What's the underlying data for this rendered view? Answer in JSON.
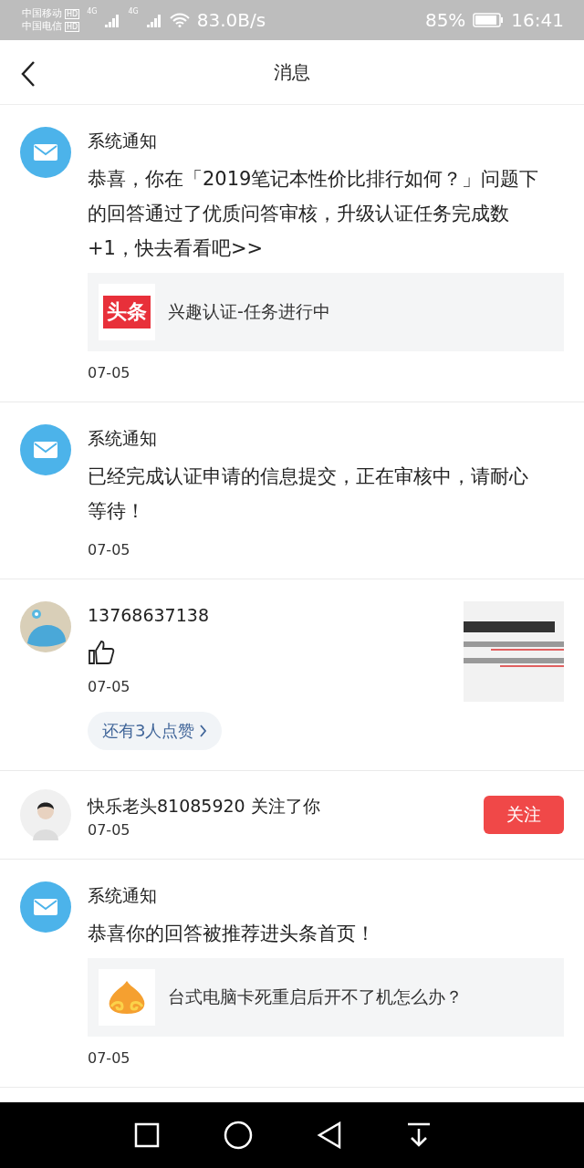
{
  "status_bar": {
    "carrier_1": "中国移动",
    "carrier_2": "中国电信",
    "hd_1": "HD",
    "hd_2": "HD",
    "net_1": "4G",
    "net_2": "4G",
    "speed": "83.0B/s",
    "battery": "85%",
    "time": "16:41"
  },
  "header": {
    "title": "消息"
  },
  "messages": [
    {
      "kind": "system",
      "title": "系统通知",
      "body": "恭喜，你在「2019笔记本性价比排行如何？」问题下的回答通过了优质问答审核，升级认证任务完成数+1，快去看看吧>>",
      "card": {
        "kind": "text_logo",
        "logo_text": "头条",
        "text": "兴趣认证-任务进行中"
      },
      "date": "07-05"
    },
    {
      "kind": "system",
      "title": "系统通知",
      "body": "已经完成认证申请的信息提交，正在审核中，请耐心等待！",
      "date": "07-05"
    },
    {
      "kind": "like",
      "name": "13768637138",
      "date": "07-05",
      "more": "还有3人点赞"
    },
    {
      "kind": "follow",
      "text": "快乐老头81085920 关注了你",
      "date": "07-05",
      "button": "关注"
    },
    {
      "kind": "system",
      "title": "系统通知",
      "body": "恭喜你的回答被推荐进头条首页！",
      "card": {
        "kind": "cloud_logo",
        "text": "台式电脑卡死重启后开不了机怎么办？"
      },
      "date": "07-05"
    }
  ]
}
